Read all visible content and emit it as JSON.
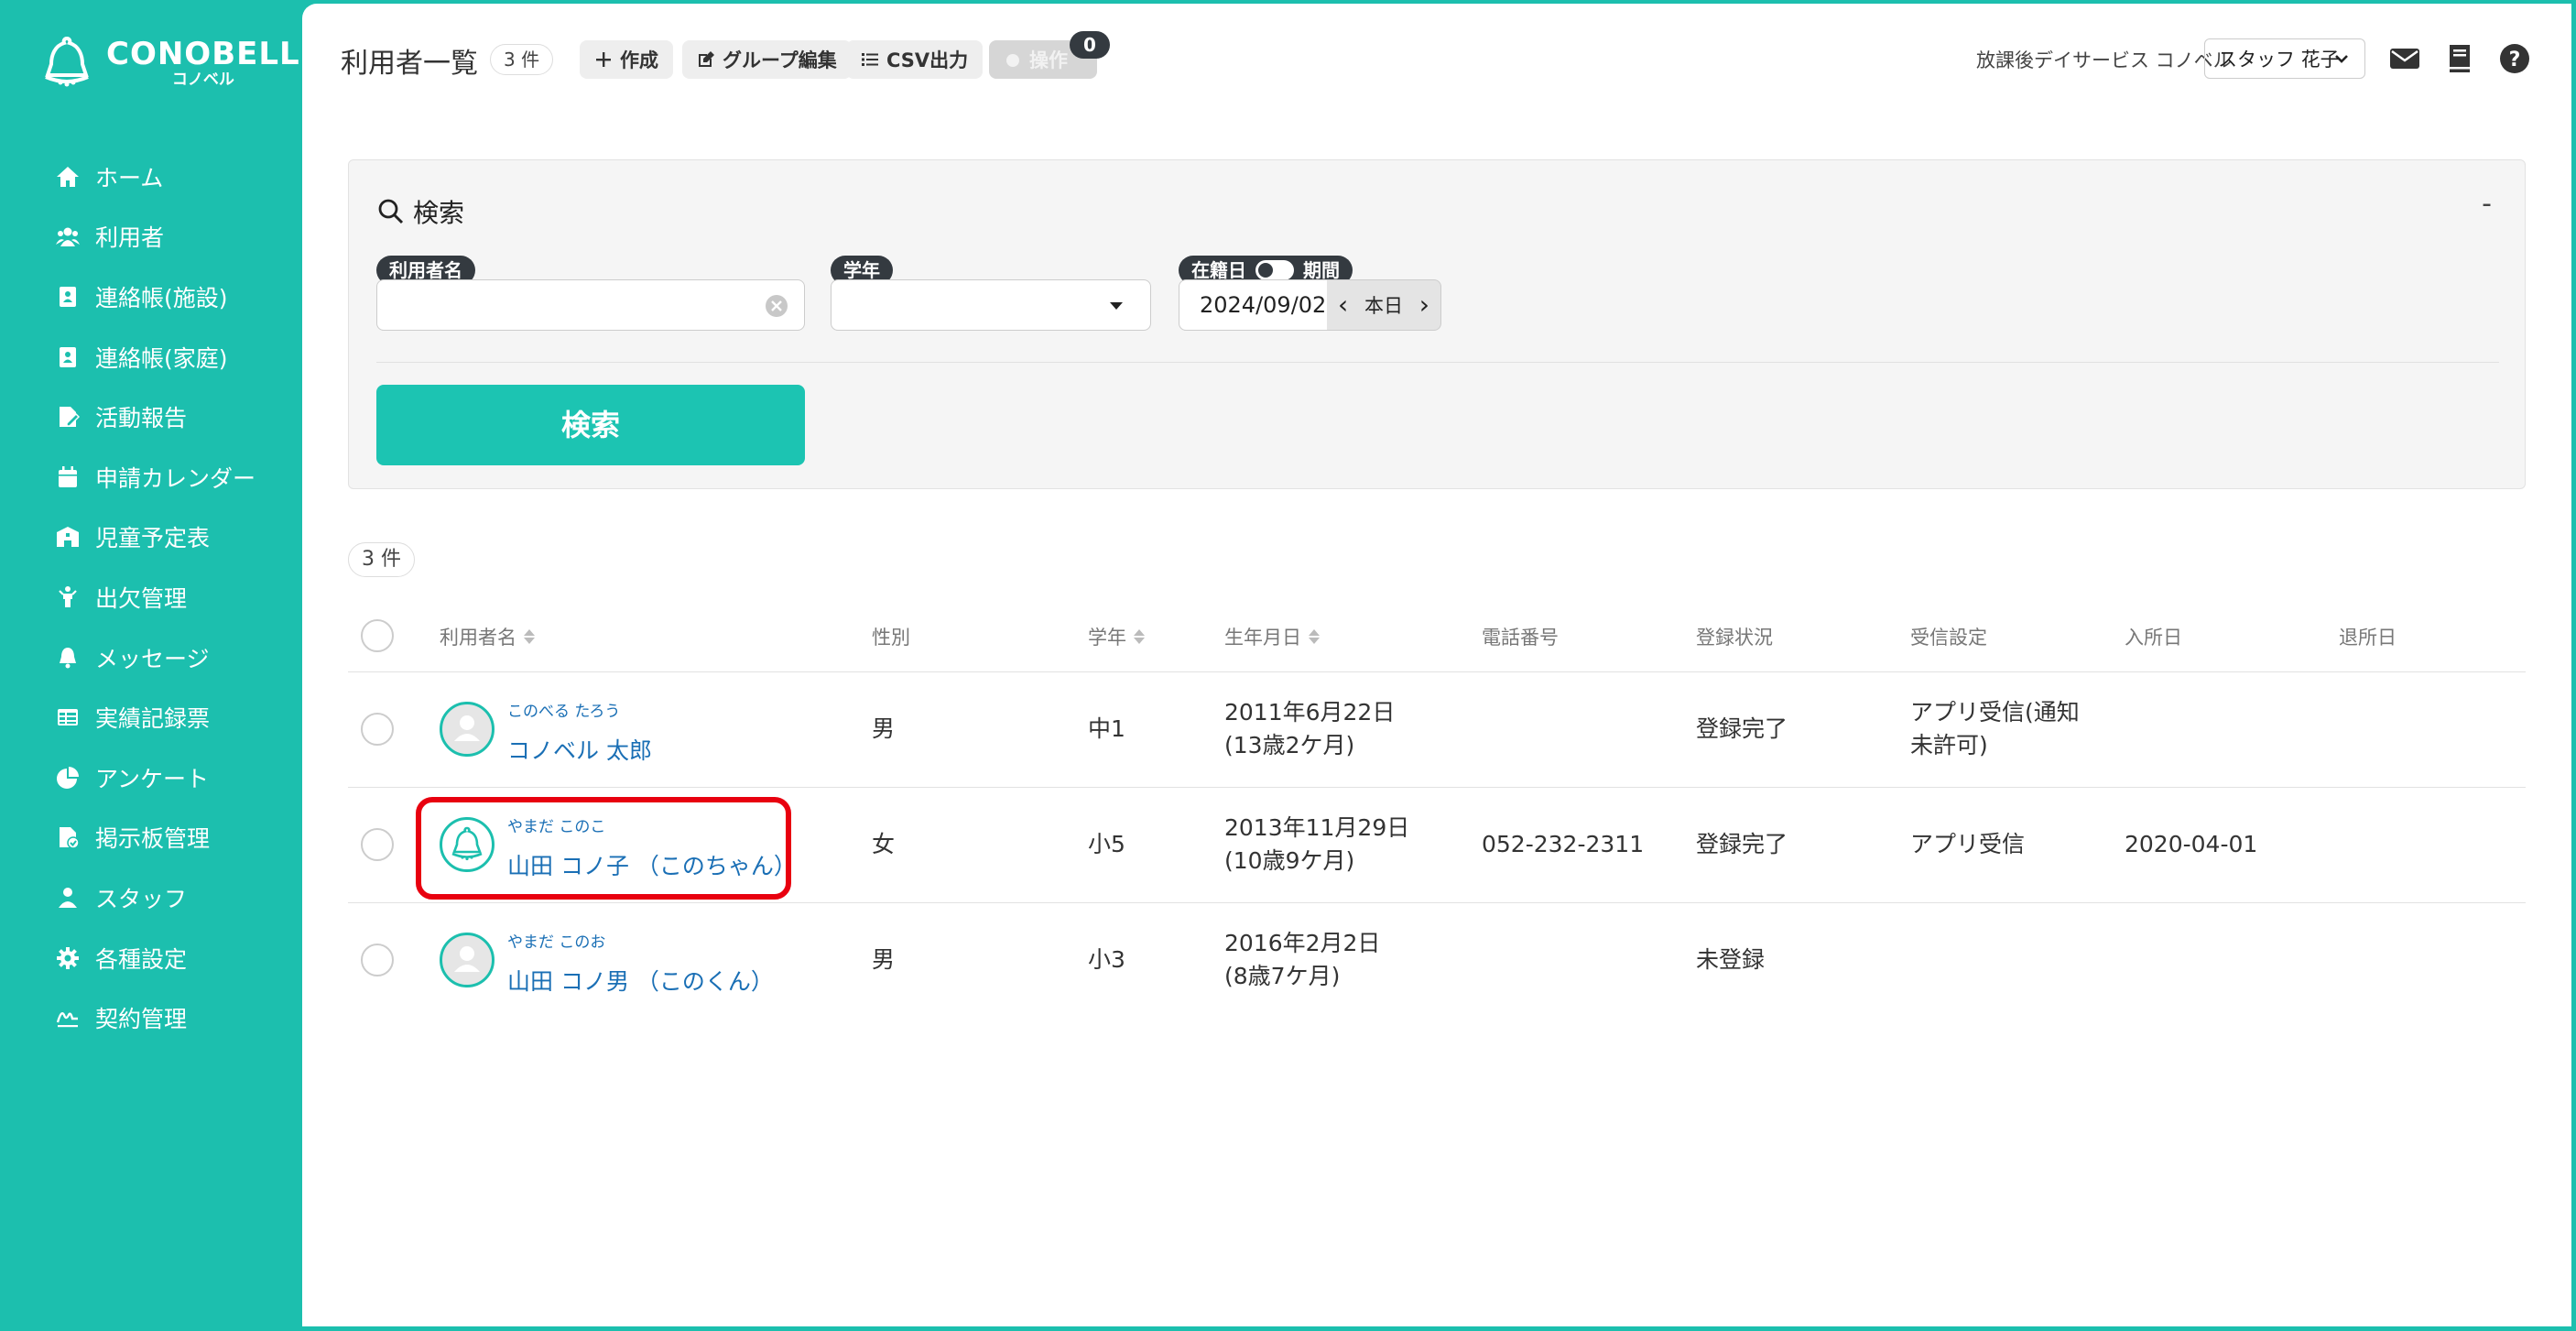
{
  "brand": {
    "name": "CONOBELL",
    "sub": "コノベル"
  },
  "nav": [
    {
      "label": "ホーム",
      "icon": "home-icon"
    },
    {
      "label": "利用者",
      "icon": "users-icon"
    },
    {
      "label": "連絡帳(施設)",
      "icon": "contact-book-icon"
    },
    {
      "label": "連絡帳(家庭)",
      "icon": "contact-book-icon"
    },
    {
      "label": "活動報告",
      "icon": "file-edit-icon"
    },
    {
      "label": "申請カレンダー",
      "icon": "calendar-icon"
    },
    {
      "label": "児童予定表",
      "icon": "school-icon"
    },
    {
      "label": "出欠管理",
      "icon": "person-icon"
    },
    {
      "label": "メッセージ",
      "icon": "bell-icon"
    },
    {
      "label": "実績記録票",
      "icon": "table-icon"
    },
    {
      "label": "アンケート",
      "icon": "pie-chart-icon"
    },
    {
      "label": "掲示板管理",
      "icon": "file-check-icon"
    },
    {
      "label": "スタッフ",
      "icon": "staff-icon"
    },
    {
      "label": "各種設定",
      "icon": "gear-icon"
    },
    {
      "label": "契約管理",
      "icon": "signature-icon"
    }
  ],
  "header": {
    "title": "利用者一覧",
    "count": "3 件",
    "create": "作成",
    "group_edit": "グループ編集",
    "csv": "CSV出力",
    "operation": "操作",
    "operation_badge": "0",
    "facility": "放課後デイサービス コノベル",
    "staff": "スタッフ 花子"
  },
  "search": {
    "title": "検索",
    "collapse": "-",
    "name_label": "利用者名",
    "name_value": "",
    "grade_label": "学年",
    "grade_value": "",
    "date_label_left": "在籍日",
    "date_label_right": "期間",
    "date_value": "2024/09/02",
    "today": "本日",
    "button": "検索"
  },
  "results": {
    "count": "3 件",
    "columns": {
      "name": "利用者名",
      "gender": "性別",
      "grade": "学年",
      "birthday": "生年月日",
      "phone": "電話番号",
      "status": "登録状況",
      "receive": "受信設定",
      "join": "入所日",
      "leave": "退所日"
    },
    "rows": [
      {
        "kana": "このべる たろう",
        "name": "コノベル 太郎",
        "gender": "男",
        "grade": "中1",
        "birth1": "2011年6月22日",
        "birth2": "(13歳2ケ月)",
        "phone": "",
        "status": "登録完了",
        "receive1": "アプリ受信(通知",
        "receive2": "未許可)",
        "join": "",
        "leave": ""
      },
      {
        "kana": "やまだ このこ",
        "name": "山田 コノ子 （このちゃん）",
        "gender": "女",
        "grade": "小5",
        "birth1": "2013年11月29日",
        "birth2": "(10歳9ケ月)",
        "phone": "052-232-2311",
        "status": "登録完了",
        "receive1": "アプリ受信",
        "receive2": "",
        "join": "2020-04-01",
        "leave": ""
      },
      {
        "kana": "やまだ このお",
        "name": "山田 コノ男 （このくん）",
        "gender": "男",
        "grade": "小3",
        "birth1": "2016年2月2日",
        "birth2": "(8歳7ケ月)",
        "phone": "",
        "status": "未登録",
        "receive1": "",
        "receive2": "",
        "join": "",
        "leave": ""
      }
    ]
  },
  "colors": {
    "accent": "#1cbfae",
    "highlight": "#e8000f",
    "link": "#1a6fb5"
  }
}
